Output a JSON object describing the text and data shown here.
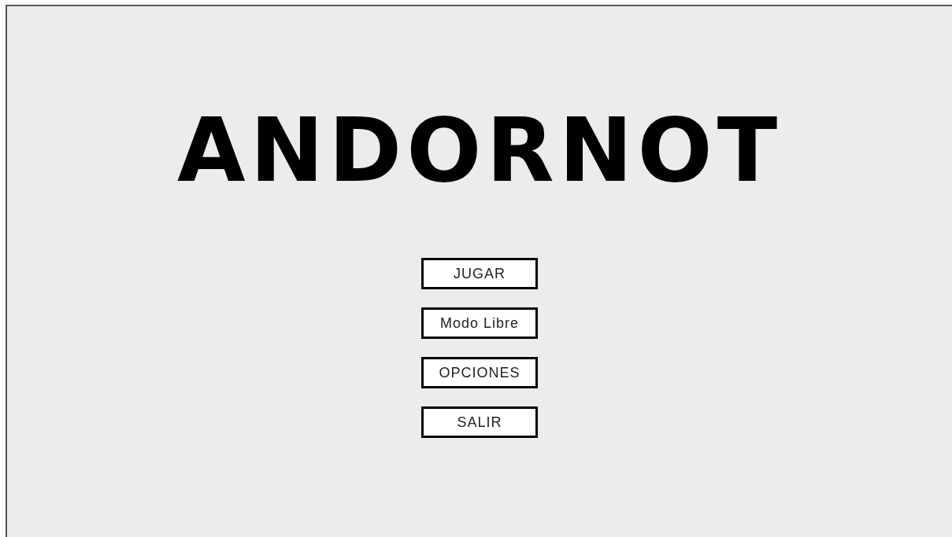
{
  "title": "ANDORNOT",
  "menu": [
    {
      "label": "JUGAR"
    },
    {
      "label": "Modo Libre"
    },
    {
      "label": "OPCIONES"
    },
    {
      "label": "SALIR"
    }
  ]
}
